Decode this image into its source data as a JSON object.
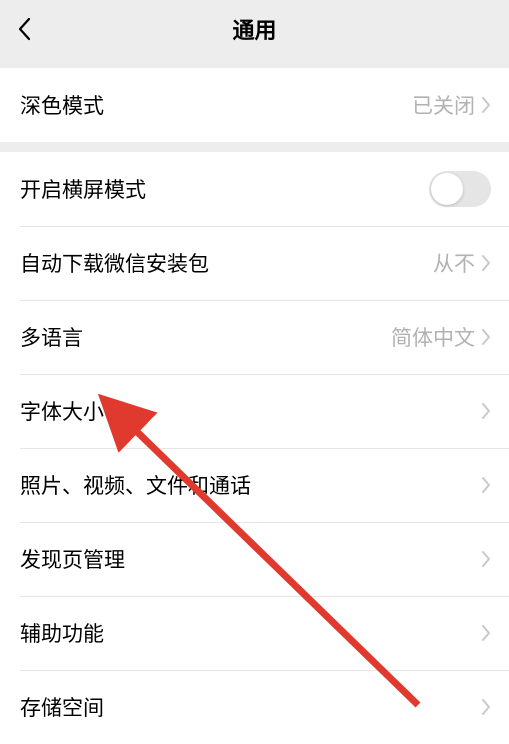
{
  "header": {
    "title": "通用"
  },
  "section1": {
    "dark_mode": {
      "label": "深色模式",
      "value": "已关闭"
    }
  },
  "section2": {
    "landscape": {
      "label": "开启横屏模式",
      "toggle_on": false
    },
    "auto_download": {
      "label": "自动下载微信安装包",
      "value": "从不"
    },
    "language": {
      "label": "多语言",
      "value": "简体中文"
    },
    "font_size": {
      "label": "字体大小"
    },
    "media": {
      "label": "照片、视频、文件和通话"
    },
    "discover": {
      "label": "发现页管理"
    },
    "accessibility": {
      "label": "辅助功能"
    },
    "storage": {
      "label": "存储空间"
    }
  },
  "annotation": {
    "arrow_color": "#e03a2f"
  }
}
